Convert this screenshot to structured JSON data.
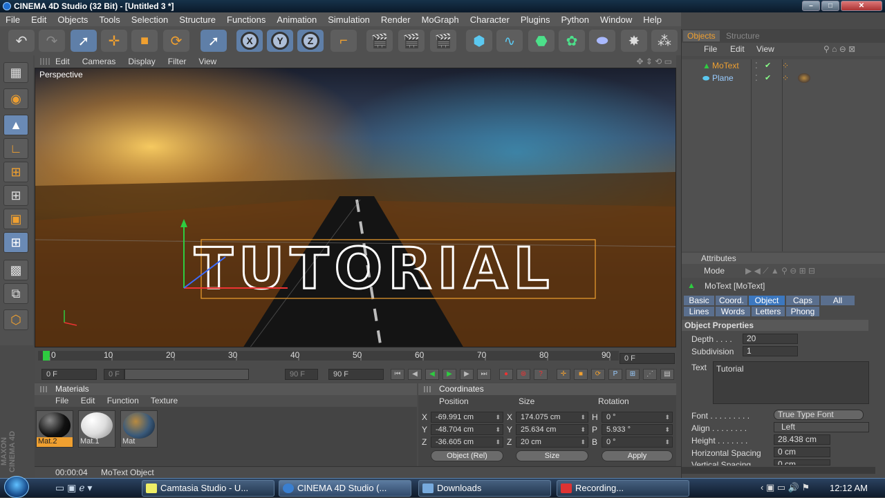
{
  "window": {
    "title": "CINEMA 4D Studio (32 Bit) - [Untitled 3 *]"
  },
  "menu": [
    "File",
    "Edit",
    "Objects",
    "Tools",
    "Selection",
    "Structure",
    "Functions",
    "Animation",
    "Simulation",
    "Render",
    "MoGraph",
    "Character",
    "Plugins",
    "Python",
    "Window",
    "Help"
  ],
  "toolbar": {
    "axis_x": "X",
    "axis_y": "Y",
    "axis_z": "Z"
  },
  "viewport": {
    "menu": [
      "Edit",
      "Cameras",
      "Display",
      "Filter",
      "View"
    ],
    "label": "Perspective",
    "scene_text": "TUTORIAL"
  },
  "timeline": {
    "ticks": [
      "0",
      "10",
      "20",
      "30",
      "40",
      "50",
      "60",
      "70",
      "80",
      "90"
    ],
    "current_frame_right": "0 F",
    "start_frame": "0 F",
    "range_start": "0 F",
    "range_end": "90 F",
    "end_frame": "90 F"
  },
  "materials": {
    "title": "Materials",
    "menu": [
      "File",
      "Edit",
      "Function",
      "Texture"
    ],
    "items": [
      {
        "name": "Mat.2",
        "selected": true
      },
      {
        "name": "Mat.1",
        "selected": false
      },
      {
        "name": "Mat",
        "selected": false
      }
    ]
  },
  "coordinates": {
    "title": "Coordinates",
    "col_position": "Position",
    "col_size": "Size",
    "col_rotation": "Rotation",
    "rows": [
      {
        "axis": "X",
        "pos": "-69.991 cm",
        "saxis": "X",
        "size": "174.075 cm",
        "raxis": "H",
        "rot": "0 °"
      },
      {
        "axis": "Y",
        "pos": "-48.704 cm",
        "saxis": "Y",
        "size": "25.634 cm",
        "raxis": "P",
        "rot": "5.933 °"
      },
      {
        "axis": "Z",
        "pos": "-36.605 cm",
        "saxis": "Z",
        "size": "20 cm",
        "raxis": "B",
        "rot": "0 °"
      }
    ],
    "mode_select": "Object (Rel)",
    "size_select": "Size",
    "apply": "Apply"
  },
  "status": {
    "time": "00:00:04",
    "message": "MoText Object"
  },
  "objects": {
    "tab_objects": "Objects",
    "tab_structure": "Structure",
    "menu": [
      "File",
      "Edit",
      "View"
    ],
    "items": [
      {
        "name": "MoText",
        "highlight": true
      },
      {
        "name": "Plane",
        "highlight": false
      }
    ]
  },
  "attributes": {
    "title": "Attributes",
    "mode": "Mode",
    "object_name": "MoText [MoText]",
    "tabs_row1": [
      "Basic",
      "Coord.",
      "Object",
      "Caps",
      "All"
    ],
    "tabs_row2": [
      "Lines",
      "Words",
      "Letters",
      "Phong"
    ],
    "selected_tab": "Object",
    "section": "Object Properties",
    "depth_label": "Depth . . . .",
    "depth": "20",
    "subdivision_label": "Subdivision",
    "subdivision": "1",
    "text_label": "Text",
    "text_value": "Tutorial",
    "font_label": "Font . . . . . . . . .",
    "font_value": "True Type Font",
    "align_label": "Align . . . . . . . .",
    "align_value": "Left",
    "height_label": "Height . . . . . . .",
    "height_value": "28.438 cm",
    "hspacing_label": "Horizontal Spacing",
    "hspacing_value": "0 cm",
    "vspacing_label": "Vertical Spacing",
    "vspacing_value": "0 cm"
  },
  "taskbar": {
    "items": [
      "Camtasia Studio - U...",
      "CINEMA 4D Studio (...",
      "Downloads",
      "Recording..."
    ],
    "clock": "12:12 AM"
  },
  "colors": {
    "accent": "#3c78c0",
    "highlight": "#f0a030",
    "menu_bg": "#585858"
  }
}
